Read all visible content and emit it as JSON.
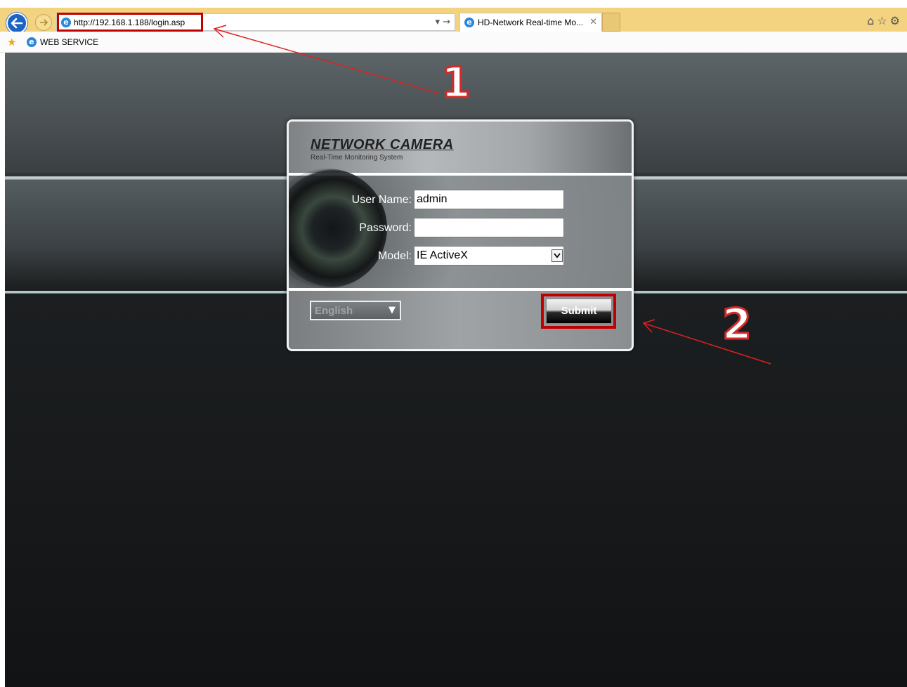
{
  "browser": {
    "address_url": "http://192.168.1.188/login.asp",
    "address_go": "▾ →",
    "tab_title": "HD-Network Real-time Mo...",
    "tab_close": "✕",
    "toolbar_icons": "⌂☆⚙",
    "favorites_item": "WEB SERVICE"
  },
  "login": {
    "brand_title": "NETWORK CAMERA",
    "brand_subtitle": "Real-Time Monitoring System",
    "username_label": "User Name:",
    "username_value": "admin",
    "password_label": "Password:",
    "password_value": "",
    "model_label": "Model:",
    "model_value": "IE ActiveX",
    "language_value": "English",
    "submit_label": "Submit"
  },
  "annotations": {
    "step1": "1",
    "step2": "2"
  },
  "colors": {
    "annotation": "#c00000",
    "tabbar": "#f3d37f"
  }
}
